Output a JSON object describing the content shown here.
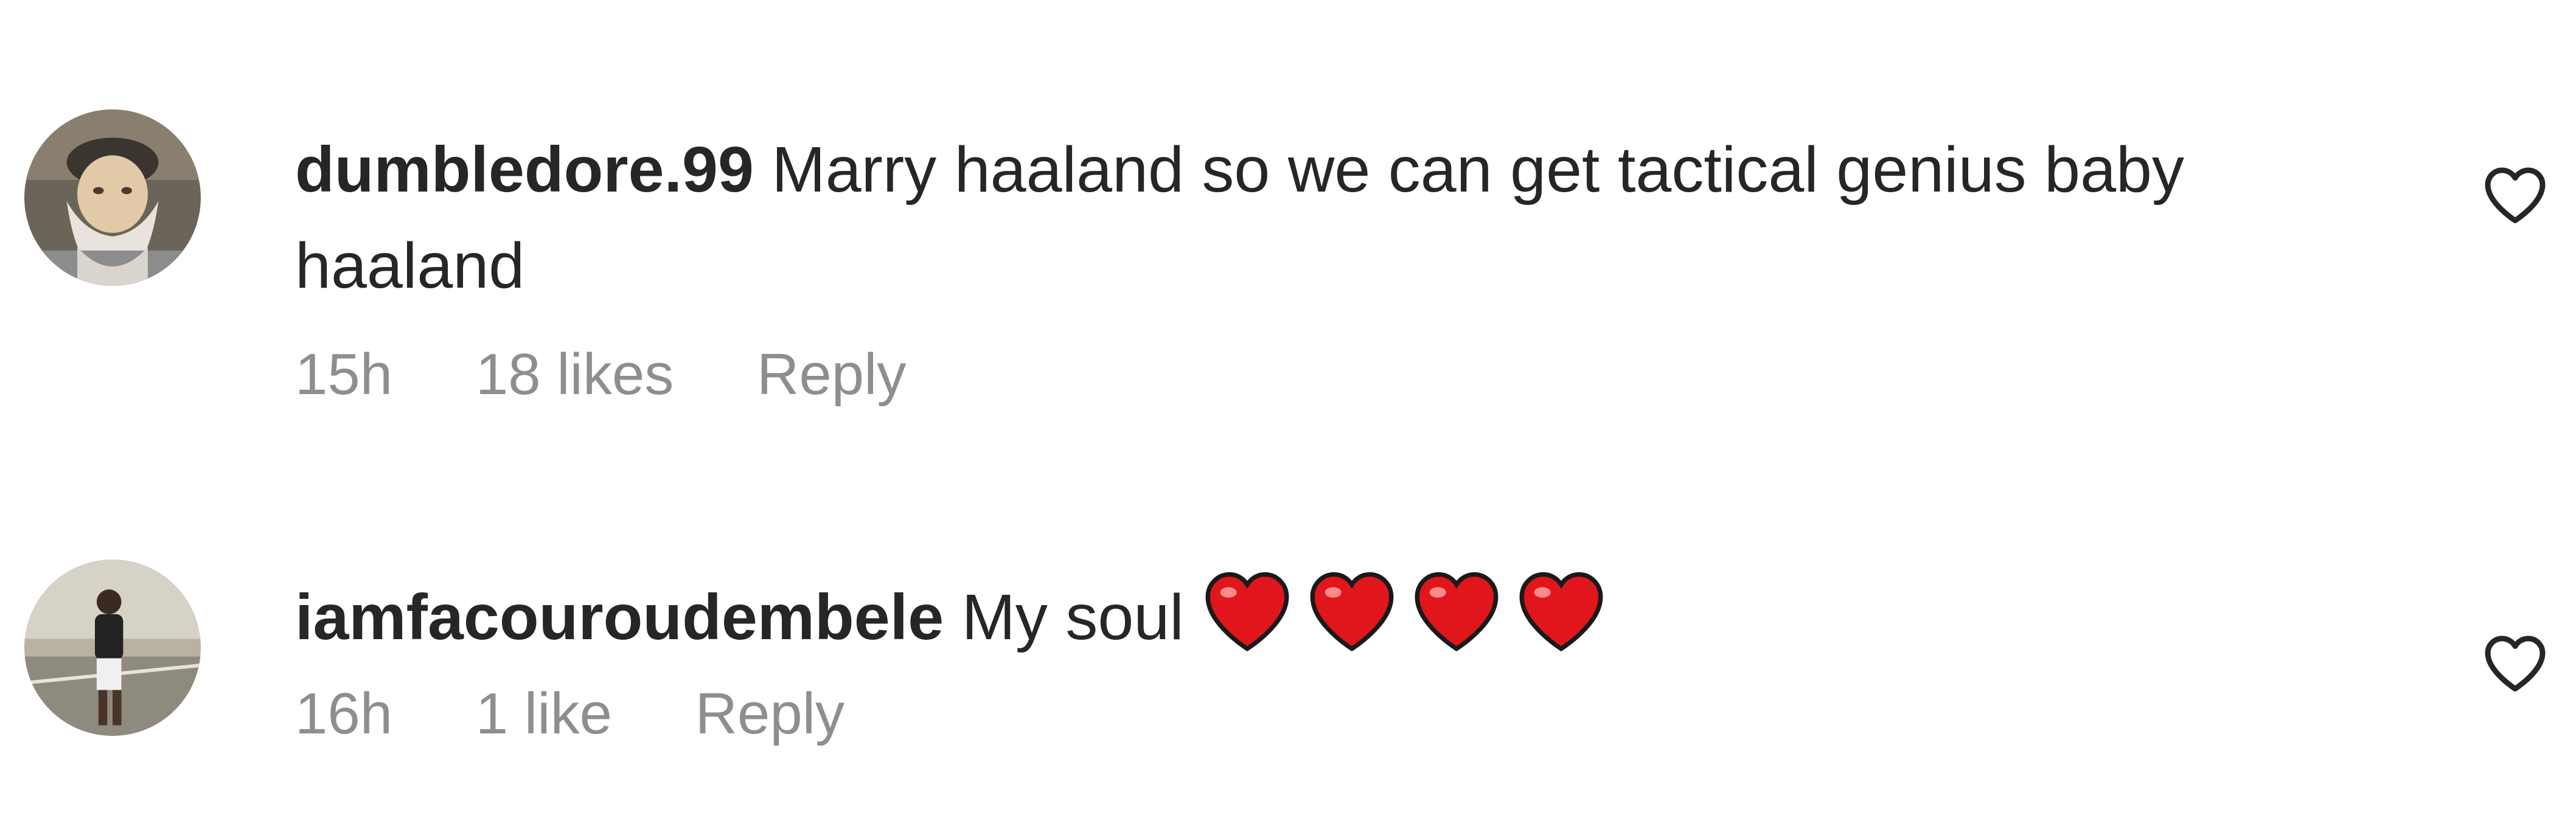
{
  "comments": [
    {
      "username": "dumbledore.99",
      "text": "Marry haaland so we can get tactical genius baby haaland",
      "time": "15h",
      "likes": "18 likes",
      "reply_label": "Reply",
      "avatar_icon": "wizard-avatar",
      "like_icon": "heart-outline-icon"
    },
    {
      "username": "iamfacouroudembele",
      "text": "My soul",
      "emojis": [
        "red-heart-emoji",
        "red-heart-emoji",
        "red-heart-emoji",
        "red-heart-emoji"
      ],
      "time": "16h",
      "likes": "1 like",
      "reply_label": "Reply",
      "avatar_icon": "person-avatar",
      "like_icon": "heart-outline-icon"
    }
  ],
  "colors": {
    "text": "#262626",
    "secondary": "#8e8e8e",
    "heart_emoji": "#e0161c"
  }
}
